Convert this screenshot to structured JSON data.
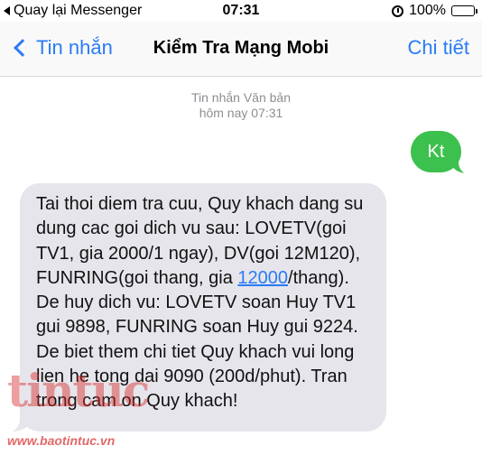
{
  "status_bar": {
    "back_to_app": "Quay lại Messenger",
    "time": "07:31",
    "battery": "100%",
    "battery_level": 1.0
  },
  "nav": {
    "back_label": "Tin nhắn",
    "title": "Kiểm Tra Mạng Mobi",
    "detail_label": "Chi tiết"
  },
  "thread": {
    "meta_type": "Tin nhắn Văn bản",
    "meta_time": "hôm nay 07:31",
    "sent_message": "Kt",
    "received": {
      "text_before_link": "Tai thoi diem tra cuu, Quy khach dang su dung cac goi dich vu sau: LOVETV(goi TV1, gia 2000/1 ngay), DV(goi 12M120), FUNRING(goi thang, gia ",
      "link_text": "12000",
      "text_after_link": "/thang). De huy dich vu: LOVETV soan Huy TV1 gui 9898, FUNRING soan Huy gui 9224. De biet them chi tiet Quy khach vui long lien he tong dai 9090 (200d/phut). Tran trong cam on Quy khach!"
    }
  },
  "watermark": {
    "logo_text": "tintuc",
    "url": "www.baotintuc.vn"
  },
  "colors": {
    "accent_blue": "#2a7bf6",
    "sent_bubble": "#3dc14e",
    "received_bubble": "#e6e5eb",
    "watermark": "#d72828"
  }
}
